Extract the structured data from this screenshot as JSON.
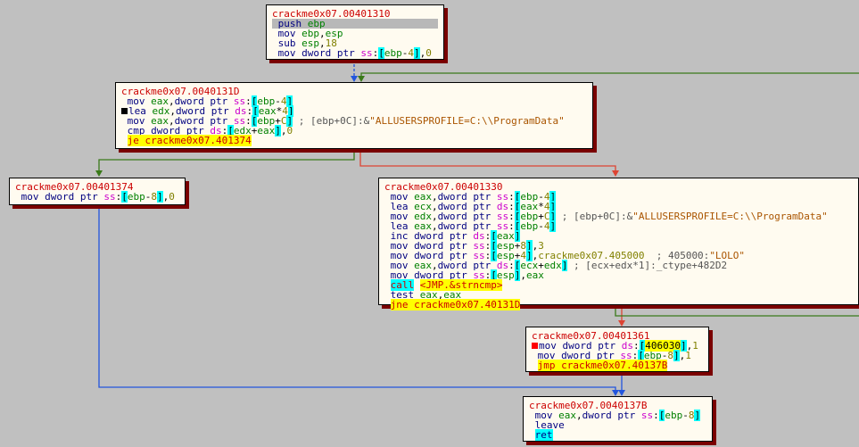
{
  "nodes": {
    "n1310": {
      "title": "crackme0x07.00401310",
      "lines": [
        "push ebp",
        "mov ebp,esp",
        "sub esp,18",
        "mov dword ptr ss:[ebp-4],0"
      ]
    },
    "n131d": {
      "title": "crackme0x07.0040131D",
      "lines": [
        "mov eax,dword ptr ss:[ebp-4]",
        "lea edx,dword ptr ds:[eax*4]",
        "mov eax,dword ptr ss:[ebp+C] ; [ebp+0C]:&\"ALLUSERSPROFILE=C:\\\\ProgramData\"",
        "cmp dword ptr ds:[edx+eax],0",
        "je crackme0x07.401374"
      ]
    },
    "n1374": {
      "title": "crackme0x07.00401374",
      "lines": [
        "mov dword ptr ss:[ebp-8],0"
      ]
    },
    "n1330": {
      "title": "crackme0x07.00401330",
      "lines": [
        "mov eax,dword ptr ss:[ebp-4]",
        "lea ecx,dword ptr ds:[eax*4]",
        "mov edx,dword ptr ss:[ebp+C] ; [ebp+0C]:&\"ALLUSERSPROFILE=C:\\\\ProgramData\"",
        "lea eax,dword ptr ss:[ebp-4]",
        "inc dword ptr ds:[eax]",
        "mov dword ptr ss:[esp+8],3",
        "mov dword ptr ss:[esp+4],crackme0x07.405000 ; 405000:\"LOLO\"",
        "mov eax,dword ptr ds:[ecx+edx] ; [ecx+edx*1]:_ctype+482D2",
        "mov dword ptr ss:[esp],eax",
        "call <JMP.&strncmp>",
        "test eax,eax",
        "jne crackme0x07.40131D"
      ]
    },
    "n1361": {
      "title": "crackme0x07.00401361",
      "lines": [
        "mov dword ptr ds:[406030],1",
        "mov dword ptr ss:[ebp-8],1",
        "jmp crackme0x07.40137B"
      ]
    },
    "n137b": {
      "title": "crackme0x07.0040137B",
      "lines": [
        "mov eax,dword ptr ss:[ebp-8]",
        "leave",
        "ret"
      ]
    }
  },
  "colors": {
    "background": "#c0c0c0",
    "node_bg": "#fffbf0",
    "shadow": "#7a0000",
    "edge_true": "#3a7a1a",
    "edge_false": "#dd4433",
    "edge_uncond": "#2255dd"
  }
}
